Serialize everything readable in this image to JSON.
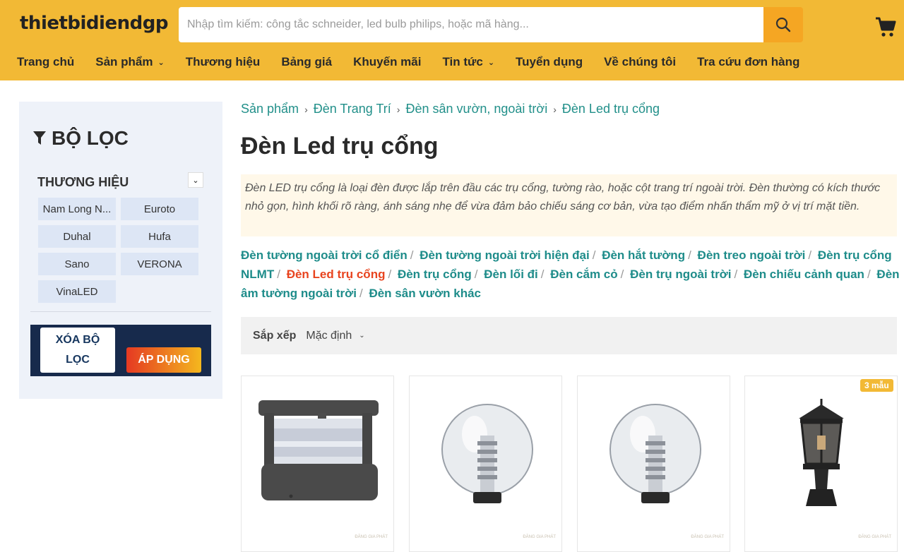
{
  "header": {
    "logo": "thietbidiendgp",
    "search_placeholder": "Nhập tìm kiếm: công tắc schneider, led bulb philips, hoặc mã hàng...",
    "nav": [
      {
        "label": "Trang chủ"
      },
      {
        "label": "Sản phẩm",
        "has_dropdown": true
      },
      {
        "label": "Thương hiệu"
      },
      {
        "label": "Bảng giá"
      },
      {
        "label": "Khuyến mãi"
      },
      {
        "label": "Tin tức",
        "has_dropdown": true
      },
      {
        "label": "Tuyển dụng"
      },
      {
        "label": "Về chúng tôi"
      },
      {
        "label": "Tra cứu đơn hàng"
      }
    ],
    "colors": {
      "bar": "#f2b935",
      "search_button": "#f5a623"
    },
    "icons": {
      "search": "search-icon",
      "cart": "cart-icon"
    }
  },
  "sidebar": {
    "title": "BỘ LỌC",
    "brand_section": "THƯƠNG HIỆU",
    "brands": [
      "Nam Long N...",
      "Euroto",
      "Duhal",
      "Hufa",
      "Sano",
      "VERONA",
      "VinaLED"
    ],
    "clear_label": "XÓA BỘ LỌC",
    "apply_label": "ÁP DỤNG"
  },
  "main": {
    "breadcrumb": [
      "Sản phẩm",
      "Đèn Trang Trí",
      "Đèn sân vườn, ngoài trời",
      "Đèn Led trụ cổng"
    ],
    "title": "Đèn Led trụ cổng",
    "description": "Đèn LED trụ cổng là loại đèn được lắp trên đầu các trụ cổng, tường rào, hoặc cột trang trí ngoài trời. Đèn thường có kích thước nhỏ gọn, hình khối rõ ràng, ánh sáng nhẹ để vừa đảm bảo chiếu sáng cơ bản, vừa tạo điểm nhấn thẩm mỹ ở vị trí mặt tiền.",
    "subcategories": [
      {
        "label": "Đèn tường ngoài trời cổ điển"
      },
      {
        "label": "Đèn tường ngoài trời hiện đại"
      },
      {
        "label": "Đèn hắt tường"
      },
      {
        "label": "Đèn treo ngoài trời"
      },
      {
        "label": "Đèn trụ cổng NLMT"
      },
      {
        "label": "Đèn Led trụ cổng",
        "active": true
      },
      {
        "label": "Đèn trụ cổng"
      },
      {
        "label": "Đèn lối đi"
      },
      {
        "label": "Đèn cắm cỏ"
      },
      {
        "label": "Đèn trụ ngoài trời"
      },
      {
        "label": "Đèn chiếu cảnh quan"
      },
      {
        "label": "Đèn âm tường ngoài trời"
      },
      {
        "label": "Đèn sân vườn khác"
      }
    ],
    "sort_label": "Sắp xếp",
    "sort_value": "Mặc định",
    "products": [
      {
        "image": "cylindrical-post-light",
        "badge": ""
      },
      {
        "image": "globe-post-light",
        "badge": ""
      },
      {
        "image": "globe-post-light",
        "badge": ""
      },
      {
        "image": "lantern-post-light",
        "badge": "3 mẫu"
      }
    ],
    "watermark": "ĐĂNG GIA PHÁT"
  }
}
